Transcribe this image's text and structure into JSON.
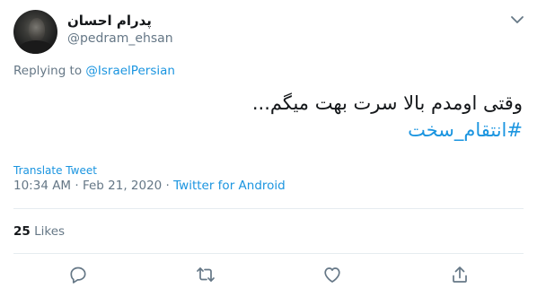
{
  "tweet": {
    "author_name": "پدرام احسان",
    "author_handle": "@pedram_ehsan",
    "replying_prefix": "Replying to ",
    "replying_to": "@IsraelPersian",
    "text_line1": "وقتی اومدم بالا سرت بهت میگم...",
    "hashtag": "#انتقام_سخت",
    "translate_label": "Translate Tweet",
    "timestamp": "10:34 AM · Feb 21, 2020 · ",
    "source": "Twitter for Android",
    "likes_count": "25",
    "likes_label": " Likes"
  },
  "icons": {
    "menu": "chevron-down-icon",
    "reply": "reply-icon",
    "retweet": "retweet-icon",
    "like": "heart-icon",
    "share": "share-icon"
  },
  "colors": {
    "accent": "#1b95e0",
    "muted": "#657786",
    "text": "#14171a",
    "divider": "#e6ecf0"
  }
}
